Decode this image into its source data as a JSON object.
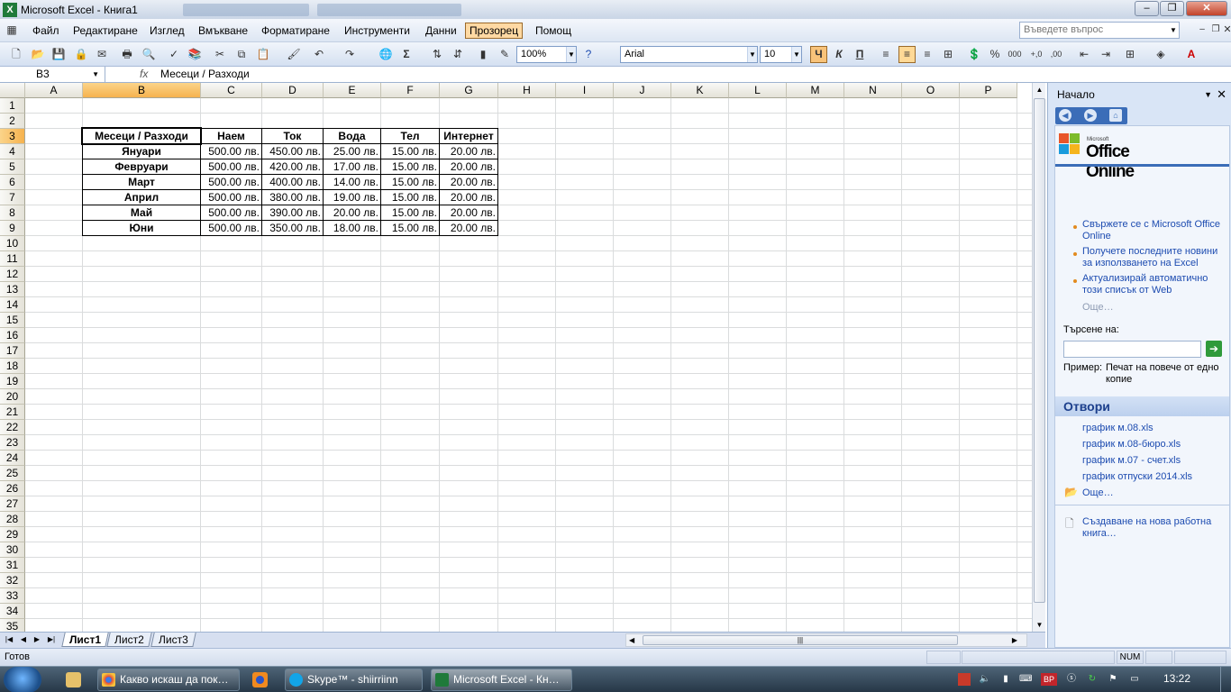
{
  "window": {
    "title": "Microsoft Excel - Книга1"
  },
  "menu": {
    "items": [
      "Файл",
      "Редактиране",
      "Изглед",
      "Вмъкване",
      "Форматиране",
      "Инструменти",
      "Данни",
      "Прозорец",
      "Помощ"
    ],
    "active": "Прозорец",
    "help_placeholder": "Въведете въпрос"
  },
  "toolbar": {
    "zoom": "100%",
    "font": "Arial",
    "font_size": "10",
    "bold_label": "Ч",
    "italic_label": "К",
    "underline_label": "П"
  },
  "formula_bar": {
    "name_box": "B3",
    "fx": "fx",
    "value": "Месеци / Разходи"
  },
  "columns": [
    "A",
    "B",
    "C",
    "D",
    "E",
    "F",
    "G",
    "H",
    "I",
    "J",
    "K",
    "L",
    "M",
    "N",
    "O",
    "P"
  ],
  "selected_column": "B",
  "selected_row": 3,
  "rows": [
    "1",
    "2",
    "3",
    "4",
    "5",
    "6",
    "7",
    "8",
    "9",
    "10",
    "11",
    "12",
    "13",
    "14",
    "15",
    "16",
    "17",
    "18",
    "19",
    "20",
    "21",
    "22",
    "23",
    "24",
    "25",
    "26",
    "27",
    "28",
    "29",
    "30",
    "31",
    "32",
    "33",
    "34",
    "35"
  ],
  "table": {
    "headers": [
      "Месеци / Разходи",
      "Наем",
      "Ток",
      "Вода",
      "Тел",
      "Интернет"
    ],
    "data": [
      [
        "Януари",
        "500.00 лв.",
        "450.00 лв.",
        "25.00 лв.",
        "15.00 лв.",
        "20.00 лв."
      ],
      [
        "Февруари",
        "500.00 лв.",
        "420.00 лв.",
        "17.00 лв.",
        "15.00 лв.",
        "20.00 лв."
      ],
      [
        "Март",
        "500.00 лв.",
        "400.00 лв.",
        "14.00 лв.",
        "15.00 лв.",
        "20.00 лв."
      ],
      [
        "Април",
        "500.00 лв.",
        "380.00 лв.",
        "19.00 лв.",
        "15.00 лв.",
        "20.00 лв."
      ],
      [
        "Май",
        "500.00 лв.",
        "390.00 лв.",
        "20.00 лв.",
        "15.00 лв.",
        "20.00 лв."
      ],
      [
        "Юни",
        "500.00 лв.",
        "350.00 лв.",
        "18.00 лв.",
        "15.00 лв.",
        "20.00 лв."
      ]
    ]
  },
  "sheets": [
    "Лист1",
    "Лист2",
    "Лист3"
  ],
  "active_sheet": "Лист1",
  "status": {
    "text": "Готов",
    "num": "NUM"
  },
  "task_pane": {
    "title": "Начало",
    "logo_ms": "Microsoft",
    "logo_text": "Office Online",
    "links": [
      "Свържете се с Microsoft Office Online",
      "Получете последните новини за използването на Excel",
      "Актуализирай автоматично този списък от Web"
    ],
    "more": "Още…",
    "search_label": "Търсене на:",
    "example_label": "Пример:",
    "example_text": "Печат на повече от едно копие",
    "open_title": "Отвори",
    "files": [
      "график м.08.xls",
      "график м.08-бюро.xls",
      "график м.07 - счет.xls",
      "график отпуски 2014.xls"
    ],
    "files_more": "Още…",
    "new_workbook": "Създаване на нова работна книга…"
  },
  "taskbar": {
    "buttons": [
      {
        "label": "Какво искаш да пок…",
        "icon": "chrome-icon"
      },
      {
        "label": "Skype™ - shiirriinn",
        "icon": "skype-icon"
      },
      {
        "label": "Microsoft Excel - Кн…",
        "icon": "excel-icon"
      }
    ],
    "lang": "BP",
    "clock": "13:22"
  },
  "colors": {
    "accent": "#3b6db8",
    "selected_header": "#f6b24e",
    "excel_green": "#1f7a3a"
  }
}
